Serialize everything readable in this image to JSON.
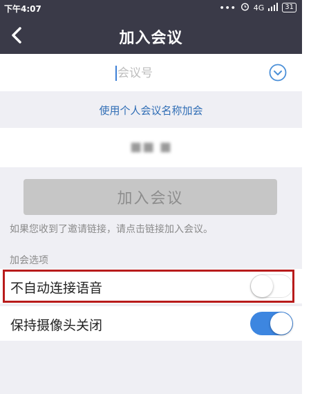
{
  "status_bar": {
    "time": "下午4:07",
    "network": "4G",
    "battery": "31"
  },
  "nav": {
    "title": "加入会议"
  },
  "meeting_id": {
    "placeholder": "会议号"
  },
  "personal_link": "使用个人会议名称加会",
  "display_name": "■■ ■",
  "join_button": "加入会议",
  "hint": "如果您收到了邀请链接，请点击链接加入会议。",
  "options": {
    "section_label": "加会选项",
    "items": [
      {
        "label": "不自动连接语音",
        "enabled": false
      },
      {
        "label": "保持摄像头关闭",
        "enabled": true
      }
    ]
  },
  "colors": {
    "header": "#3a3a48",
    "accent": "#3d86e0",
    "link": "#2f6db5",
    "highlight": "#b81b1b"
  }
}
